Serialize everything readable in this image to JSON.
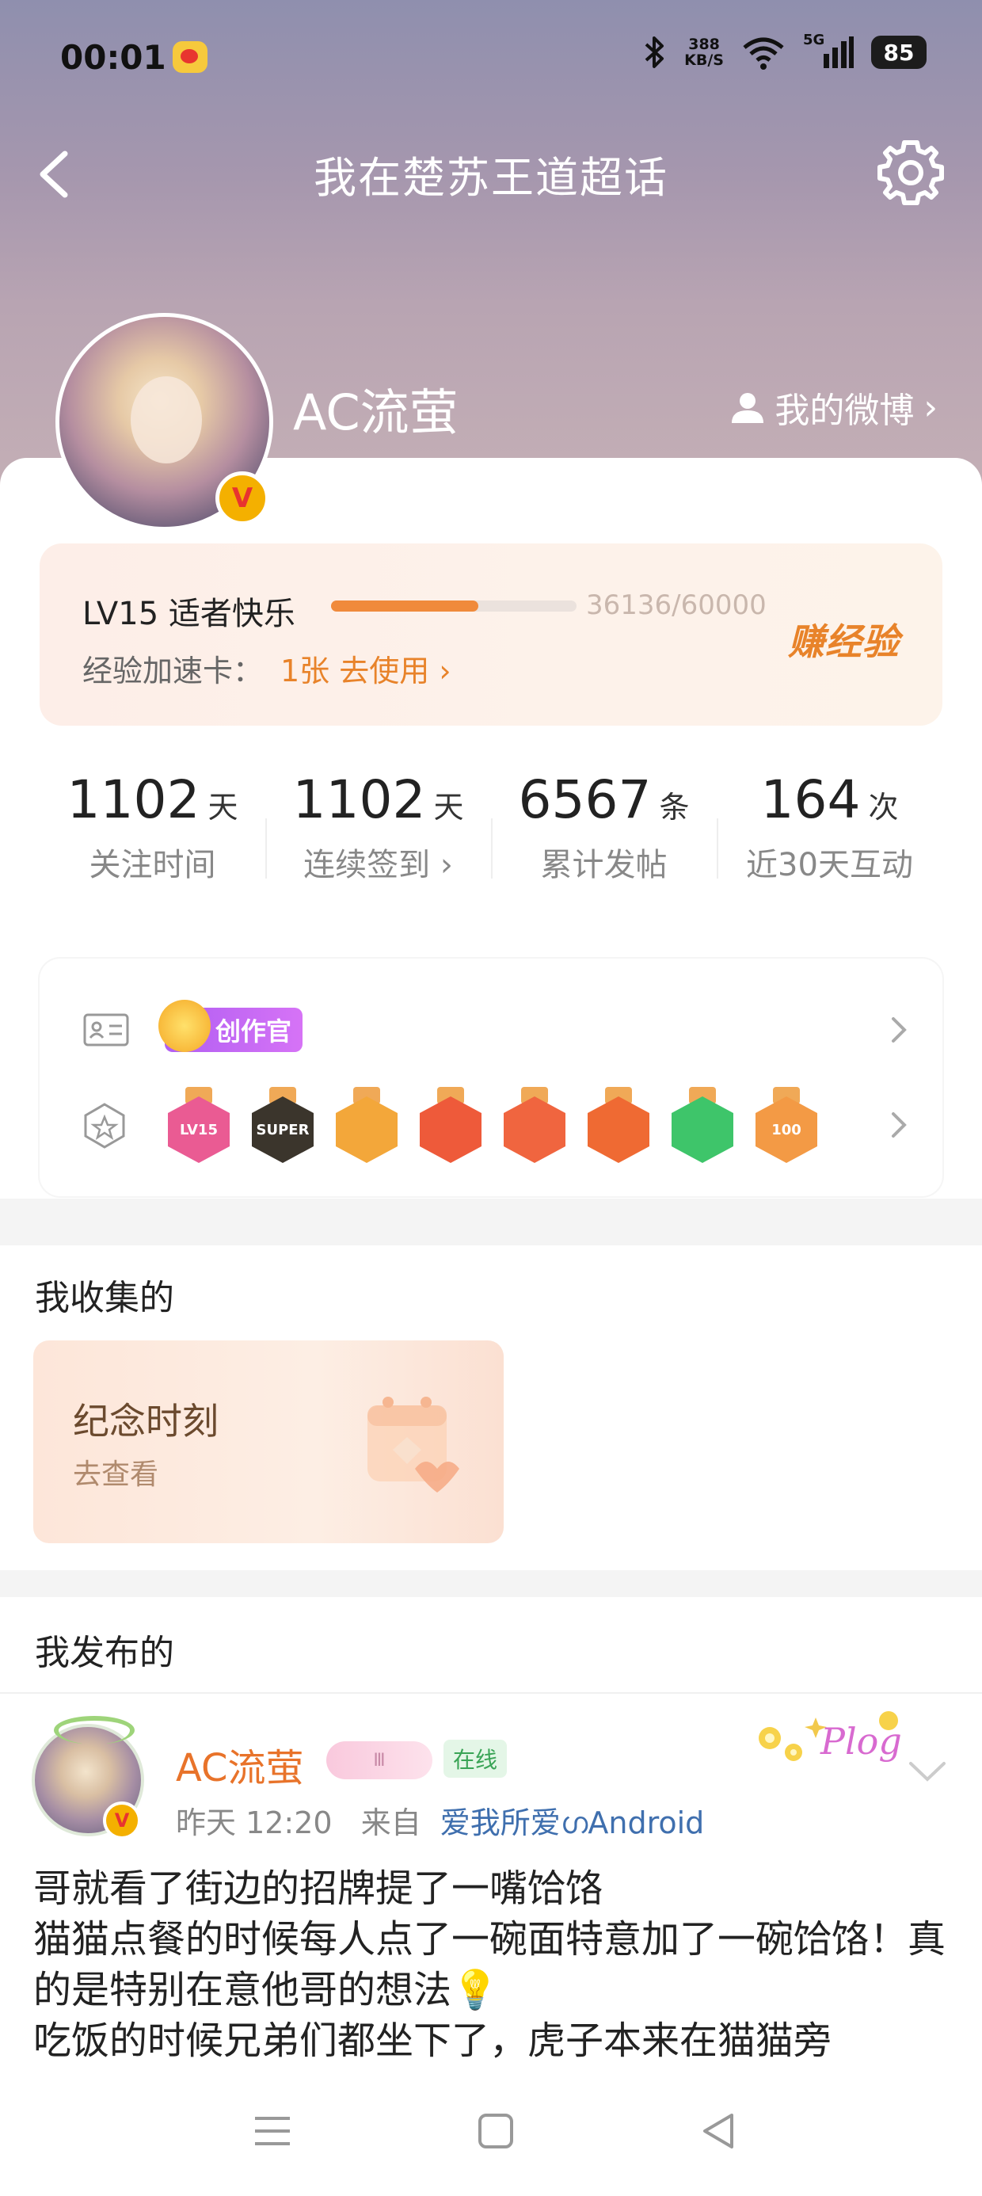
{
  "status_bar": {
    "time": "00:01",
    "net_speed_value": "388",
    "net_speed_unit": "KB/S",
    "signal_label": "5G",
    "battery": "85"
  },
  "header": {
    "title": "我在楚苏王道超话"
  },
  "profile": {
    "username": "AC流萤",
    "verified_badge": "V",
    "my_weibo_label": "我的微博",
    "my_weibo_arrow": "›"
  },
  "level": {
    "title": "LV15 适者快乐",
    "progress": 0.6,
    "exp_text": "36136/60000",
    "earn_exp_label": "赚经验",
    "accel_label": "经验加速卡：",
    "accel_link": "1张 去使用 ›"
  },
  "stats": [
    {
      "value": "1102",
      "unit": "天",
      "label": "关注时间"
    },
    {
      "value": "1102",
      "unit": "天",
      "label": "连续签到 ›"
    },
    {
      "value": "6567",
      "unit": "条",
      "label": "累计发帖"
    },
    {
      "value": "164",
      "unit": "次",
      "label": "近30天互动"
    }
  ],
  "badges": {
    "creator_tag": "创作官",
    "medals": [
      {
        "text": "LV15",
        "color": "#ea5b93"
      },
      {
        "text": "SUPER",
        "color": "#3b352c"
      },
      {
        "text": "",
        "color": "#f3a73a"
      },
      {
        "text": "",
        "color": "#ee5a3a"
      },
      {
        "text": "",
        "color": "#f0653f"
      },
      {
        "text": "",
        "color": "#ef6a33"
      },
      {
        "text": "",
        "color": "#3ec56a"
      },
      {
        "text": "100",
        "color": "#f39a45"
      }
    ]
  },
  "collected": {
    "title": "我收集的",
    "card_title": "纪念时刻",
    "card_sub": "去查看"
  },
  "published": {
    "title": "我发布的",
    "post": {
      "author": "AC流萤",
      "fan_level": "Ⅲ",
      "online": "在线",
      "time": "昨天 12:20",
      "from_label": "来自",
      "source": "爱我所爱ഗAndroid",
      "body": "哥就看了街边的招牌提了一嘴饸饹\n猫猫点餐的时候每人点了一碗面特意加了一碗饸饹！真的是特别在意他哥的想法💡\n吃饭的时候兄弟们都坐下了，虎子本来在猫猫旁"
    }
  },
  "colors": {
    "accent_orange": "#e8832a",
    "link_blue": "#3f6fae"
  }
}
